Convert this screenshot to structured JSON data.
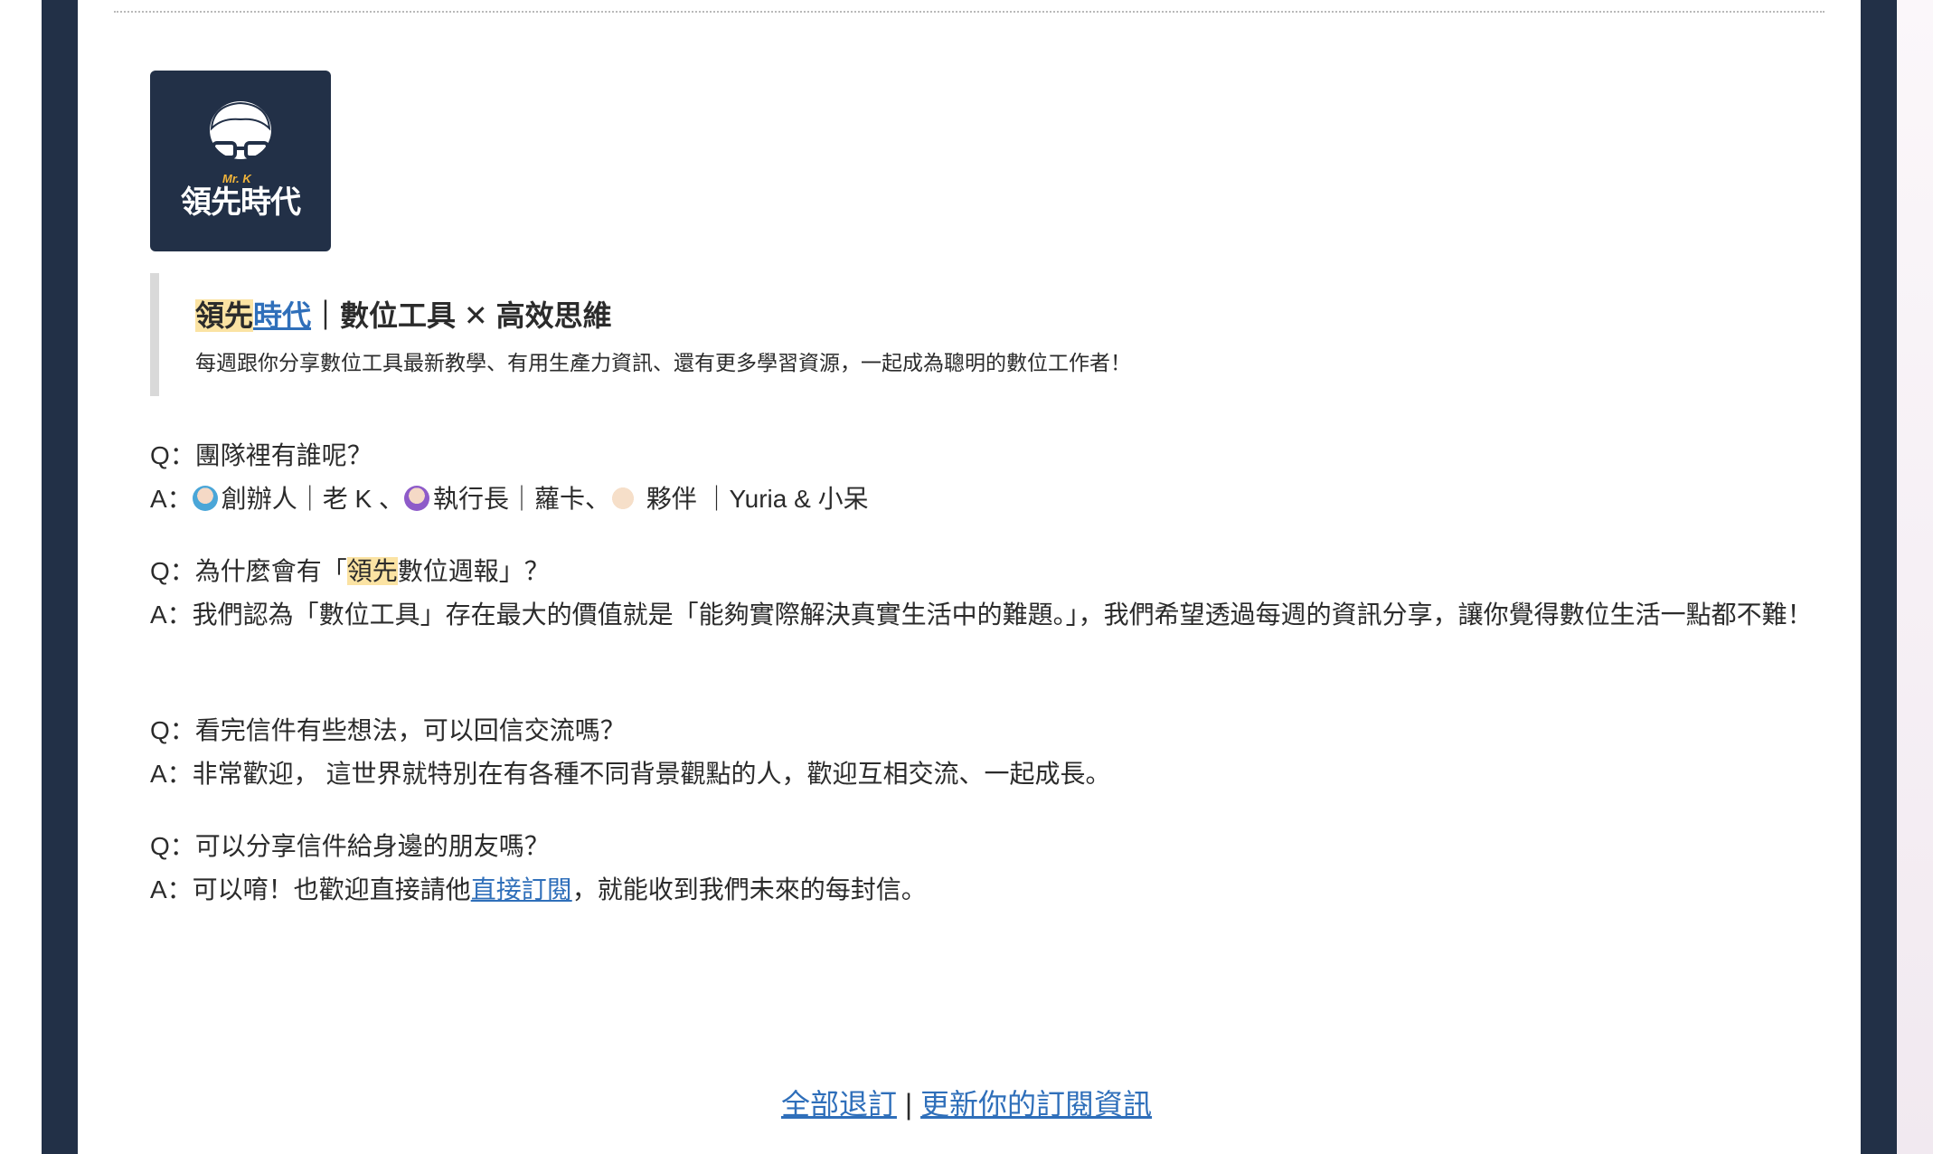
{
  "logo": {
    "brand_mark": "Mr. K",
    "text": "領先時代"
  },
  "callout": {
    "title_part1": "領先",
    "title_part2": "時代",
    "title_rest": "｜數位工具 ✕ 高效思維",
    "subtitle": "每週跟你分享數位工具最新教學、有用生產力資訊、還有更多學習資源，一起成為聰明的數位工作者！"
  },
  "faq": {
    "q1": "Q：團隊裡有誰呢？",
    "a1_prefix": "A：",
    "a1_founder": "創辦人｜老 K 、",
    "a1_ceo": "執行長｜蘿卡、",
    "a1_partners": " 夥伴 ｜Yuria & 小呆",
    "q2_prefix": "Q：為什麼會有「",
    "q2_highlight": "領先",
    "q2_suffix": "數位週報」？",
    "a2": "A：我們認為「數位工具」存在最大的價值就是「能夠實際解決真實生活中的難題。」，我們希望透過每週的資訊分享，讓你覺得數位生活一點都不難！",
    "q3": "Q：看完信件有些想法，可以回信交流嗎？",
    "a3": "A：非常歡迎， 這世界就特別在有各種不同背景觀點的人，歡迎互相交流、一起成長。",
    "q4": "Q：可以分享信件給身邊的朋友嗎？",
    "a4_prefix": "A：可以唷！也歡迎直接請他",
    "a4_link": "直接訂閱",
    "a4_suffix": "，就能收到我們未來的每封信。"
  },
  "footer": {
    "unsubscribe": "全部退訂",
    "separator": " | ",
    "update": "更新你的訂閱資訊"
  },
  "colors": {
    "navy": "#223047",
    "link": "#2f6fba",
    "highlight": "#fbe3a3"
  }
}
